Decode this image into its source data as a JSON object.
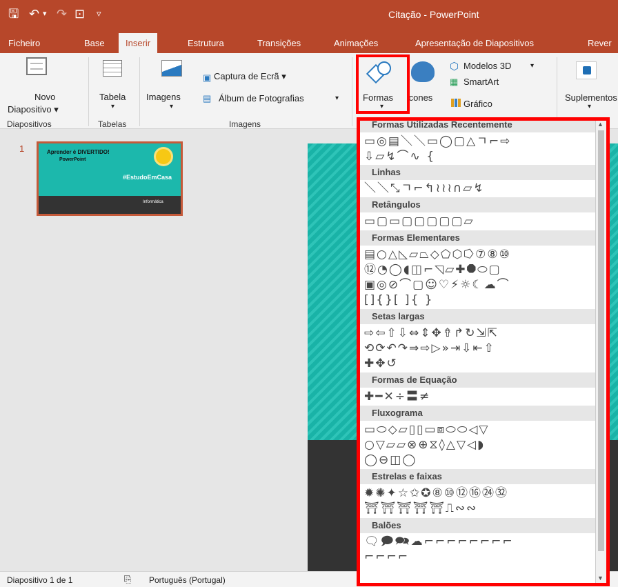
{
  "window": {
    "title": "Citação - PowerPoint"
  },
  "quick_access": {
    "save": "🖫",
    "undo": "↶",
    "undo_arrow": "▾",
    "redo": "↷",
    "present": "⊡",
    "customize": "▿"
  },
  "tabs": [
    "Ficheiro",
    "Base",
    "Inserir",
    "Estrutura",
    "Transições",
    "Animações",
    "Apresentação de Diapositivos",
    "Rever"
  ],
  "ribbon": {
    "novo_line1": "Novo",
    "novo_line2": "Diapositivo ▾",
    "group_diapositivos": "Diapositivos",
    "tabela": "Tabela",
    "tabela_arrow": "▾",
    "group_tabelas": "Tabelas",
    "imagens": "Imagens",
    "imagens_arrow": "▾",
    "captura": "Captura de Ecrã ▾",
    "album": "Álbum de Fotografias",
    "album_arrow": "▾",
    "group_imagens": "Imagens",
    "formas": "Formas",
    "formas_arrow": "▾",
    "icones": "Ícones",
    "modelos3d": "Modelos 3D",
    "modelos3d_arrow": "▾",
    "smartart": "SmartArt",
    "grafico": "Gráfico",
    "suplementos": "Suplementos",
    "suplementos_arrow": "▾"
  },
  "thumbnail": {
    "number": "1",
    "line1": "Aprender é DIVERTIDO!",
    "line2": "PowerPoint",
    "line3": "#EstudoEmCasa",
    "line4": "Informática"
  },
  "gallery": {
    "sections": [
      {
        "title": "Formas Utilizadas Recentemente",
        "rows": [
          "▭◎▤＼＼▭◯▢△ㄱ⌐⇨",
          "⇩▱↯⌒∿ {"
        ]
      },
      {
        "title": "Linhas",
        "rows": [
          "＼＼⤡ㄱ⌐↰≀≀≀∩▱↯"
        ]
      },
      {
        "title": "Retângulos",
        "rows": [
          "▭▢▭▢▢▢▢▢▱"
        ]
      },
      {
        "title": "Formas Elementares",
        "rows": [
          "▤○△◺▱⏢◇⬠⬡⭔⑦⑧⑩",
          "⑫◔◯◖◫⌐◹▱✚⯃⬭▢",
          "▣◎⊘⌒▢☺♡⚡☼☾☁⌒",
          "[]{}[ ]{ }"
        ]
      },
      {
        "title": "Setas largas",
        "rows": [
          "⇨⇦⇧⇩⇔⇕✥⇮↱↻⇲⇱",
          "⟲⟳↶↷⇒⇨▷»⇥⇩⇤⇧",
          "✚✥↺"
        ]
      },
      {
        "title": "Formas de Equação",
        "rows": [
          "✚━✕÷〓≠"
        ]
      },
      {
        "title": "Fluxograma",
        "rows": [
          "▭⬭◇▱▯▯▭⧈⬭⬭◁▽",
          "○▽▱▱⊗⊕⧖◊△▽◁◗",
          "◯⊖◫◯"
        ]
      },
      {
        "title": "Estrelas e faixas",
        "rows": [
          "✹✺✦☆✩✪⑧⑩⑫⑯㉔㉜",
          "⛩⛩⛩⛩⛩⎍∾∾"
        ]
      },
      {
        "title": "Balões",
        "rows": [
          "🗨🗩🗪☁⌐⌐⌐⌐⌐⌐⌐⌐",
          "⌐⌐⌐⌐"
        ]
      }
    ]
  },
  "status": {
    "slide": "Diapositivo 1 de 1",
    "language": "Português (Portugal)"
  },
  "colors": {
    "accent": "#b7472a",
    "highlight": "#ff0000"
  }
}
